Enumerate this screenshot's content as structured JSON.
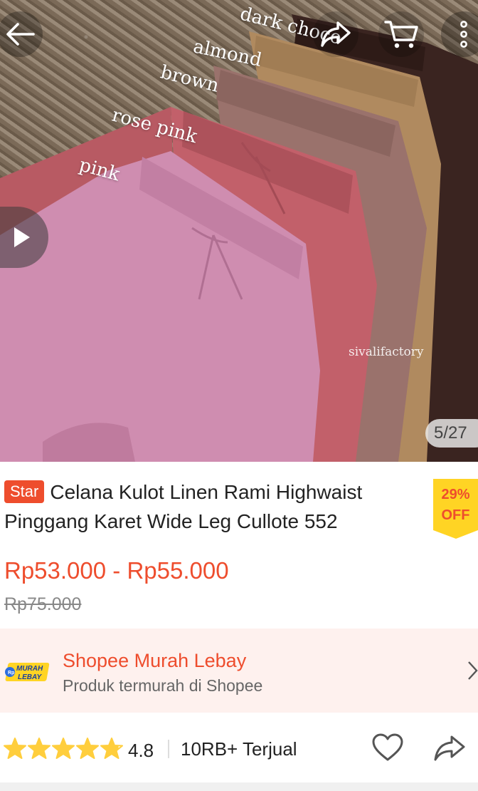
{
  "image": {
    "color_tags": [
      "dark choco",
      "almond",
      "brown",
      "rose pink",
      "pink"
    ],
    "watermark": "sivalifactory",
    "counter": "5/27"
  },
  "icons": {
    "back": "arrow-left-icon",
    "share": "share-arrow-icon",
    "cart": "cart-icon",
    "more": "more-vertical-icon",
    "play": "play-icon"
  },
  "product": {
    "badge": "Star",
    "title": "Celana Kulot Linen Rami Highwaist Pinggang Karet Wide Leg Cullote 552",
    "discount_percent": "29%",
    "discount_label": "OFF",
    "price": "Rp53.000 - Rp55.000",
    "original_price": "Rp75.000"
  },
  "promo": {
    "logo_line1": "MURAH",
    "logo_line2": "LEBAY",
    "title": "Shopee Murah Lebay",
    "subtitle": "Produk termurah di Shopee"
  },
  "stats": {
    "rating": "4.8",
    "rating_fraction": 0.96,
    "sold": "10RB+ Terjual"
  },
  "colors": {
    "accent": "#ee4d2d",
    "star": "#ffce3d",
    "discount_bg": "#ffd424",
    "promo_bg": "#fef1ee"
  }
}
